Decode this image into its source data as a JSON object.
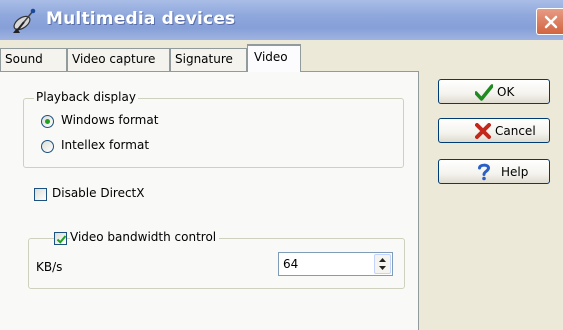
{
  "window": {
    "title": "Multimedia devices"
  },
  "tabs": [
    {
      "label": "Sound"
    },
    {
      "label": "Video capture"
    },
    {
      "label": "Signature"
    },
    {
      "label": "Video"
    }
  ],
  "active_tab": "Video",
  "video": {
    "playback_group_label": "Playback display",
    "windows_format_label": "Windows format",
    "windows_format_selected": true,
    "intellex_format_label": "Intellex format",
    "intellex_format_selected": false,
    "disable_directx_label": "Disable DirectX",
    "disable_directx_checked": false,
    "bandwidth_label": "Video bandwidth control",
    "bandwidth_checked": true,
    "kbs_label": "KB/s",
    "kbs_value": "64"
  },
  "buttons": {
    "ok_label": "OK",
    "cancel_label": "Cancel",
    "help_label": "Help"
  },
  "colors": {
    "title_bar": "#8ea7dc",
    "close_button": "#d2643f",
    "ok_check": "#1f8a1f",
    "cancel_x": "#c2281c",
    "help_mark": "#2a60c8"
  },
  "icons": {
    "app": "satellite-dish-icon",
    "close": "close-icon",
    "ok": "checkmark-icon",
    "cancel": "x-icon",
    "help": "question-mark-icon"
  }
}
